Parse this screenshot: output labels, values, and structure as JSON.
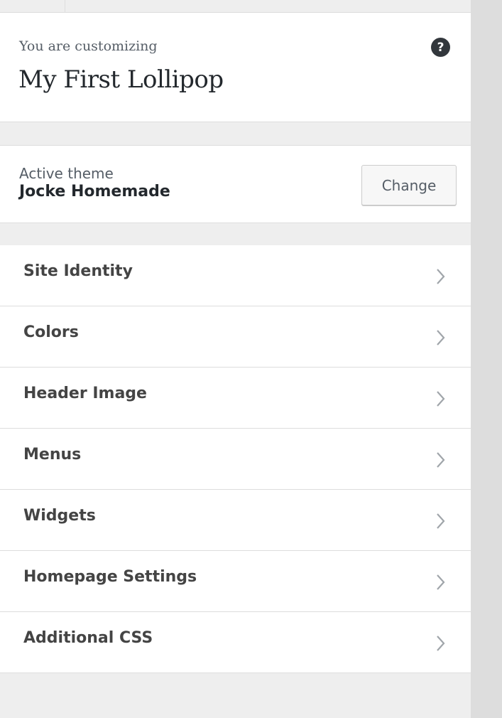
{
  "info": {
    "preamble": "You are customizing",
    "site_title": "My First Lollipop",
    "help_glyph": "?"
  },
  "theme": {
    "label": "Active theme",
    "name": "Jocke Homemade",
    "change_label": "Change"
  },
  "sections": [
    {
      "label": "Site Identity",
      "icon": "chevron-right-icon"
    },
    {
      "label": "Colors",
      "icon": "chevron-right-icon"
    },
    {
      "label": "Header Image",
      "icon": "chevron-right-icon"
    },
    {
      "label": "Menus",
      "icon": "chevron-right-icon"
    },
    {
      "label": "Widgets",
      "icon": "chevron-right-icon"
    },
    {
      "label": "Homepage Settings",
      "icon": "chevron-right-icon"
    },
    {
      "label": "Additional CSS",
      "icon": "chevron-right-icon"
    }
  ],
  "colors": {
    "panel_bg": "#eeeeee",
    "card_bg": "#ffffff",
    "border": "#dddddd",
    "text": "#23282d",
    "muted": "#555d66",
    "help_bg": "#32373c"
  }
}
